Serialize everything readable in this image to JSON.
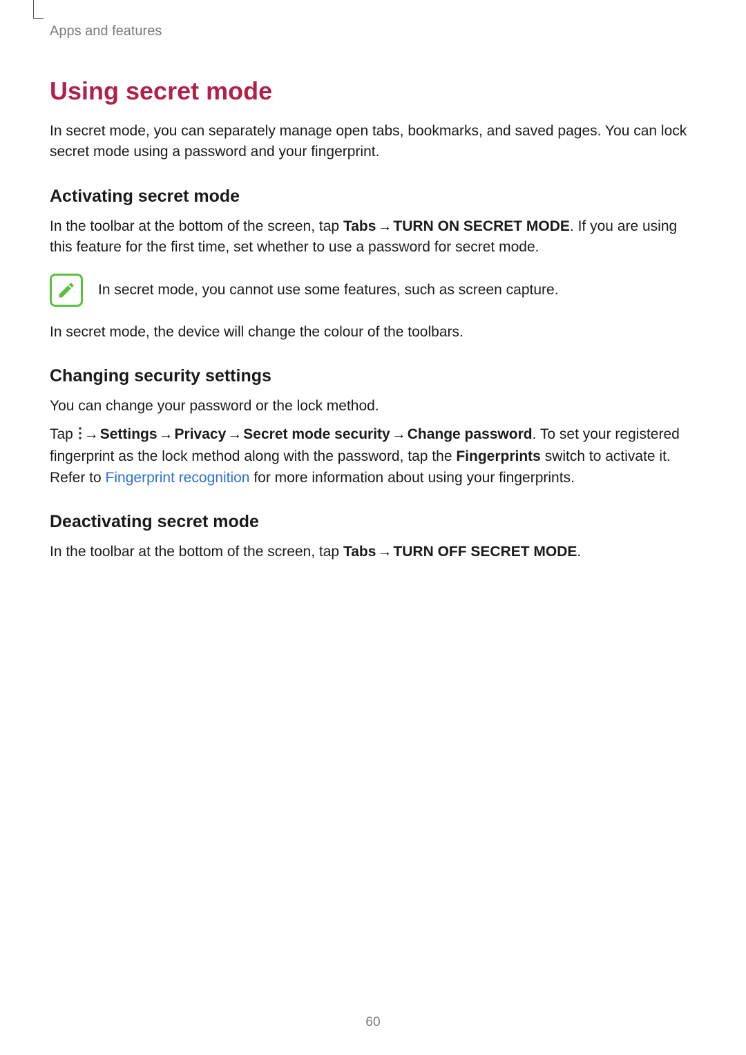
{
  "breadcrumb": "Apps and features",
  "h1": "Using secret mode",
  "intro": "In secret mode, you can separately manage open tabs, bookmarks, and saved pages. You can lock secret mode using a password and your fingerprint.",
  "sections": {
    "activating": {
      "heading": "Activating secret mode",
      "p1_a": "In the toolbar at the bottom of the screen, tap ",
      "p1_tabs": "Tabs",
      "p1_arrow1": " → ",
      "p1_turnon": "TURN ON SECRET MODE",
      "p1_b": ". If you are using this feature for the first time, set whether to use a password for secret mode.",
      "note": "In secret mode, you cannot use some features, such as screen capture.",
      "p2": "In secret mode, the device will change the colour of the toolbars."
    },
    "changing": {
      "heading": "Changing security settings",
      "p1": "You can change your password or the lock method.",
      "p2_tap": "Tap ",
      "p2_arrow1": " → ",
      "p2_settings": "Settings",
      "p2_arrow2": " → ",
      "p2_privacy": "Privacy",
      "p2_arrow3": " → ",
      "p2_sms": "Secret mode security",
      "p2_arrow4": " → ",
      "p2_change": "Change password",
      "p2_after": ". To set your registered fingerprint as the lock method along with the password, tap the ",
      "p2_fingerprints": "Fingerprints",
      "p2_after2": " switch to activate it. Refer to ",
      "p2_link": "Fingerprint recognition",
      "p2_after3": " for more information about using your fingerprints."
    },
    "deactivating": {
      "heading": "Deactivating secret mode",
      "p1_a": "In the toolbar at the bottom of the screen, tap ",
      "p1_tabs": "Tabs",
      "p1_arrow1": " → ",
      "p1_turnoff": "TURN OFF SECRET MODE",
      "p1_b": "."
    }
  },
  "page_number": "60"
}
